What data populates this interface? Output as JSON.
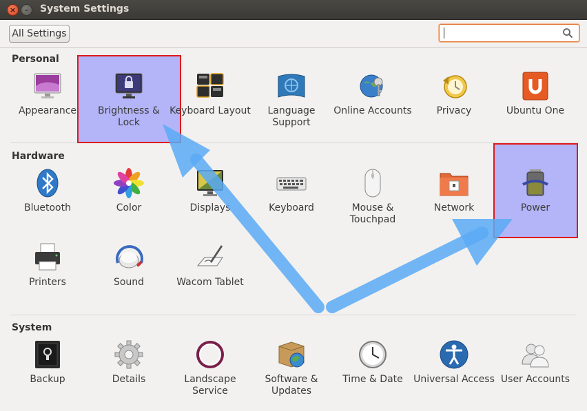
{
  "window": {
    "title": "System Settings",
    "close_glyph": "×",
    "min_glyph": "–"
  },
  "toolbar": {
    "all_settings_label": "All Settings",
    "search_value": ""
  },
  "sections": {
    "personal": "Personal",
    "hardware": "Hardware",
    "system": "System"
  },
  "personal": {
    "appearance": "Appearance",
    "brightness_lock": "Brightness & Lock",
    "keyboard_layout": "Keyboard Layout",
    "language_support": "Language Support",
    "online_accounts": "Online Accounts",
    "privacy": "Privacy",
    "ubuntu_one": "Ubuntu One"
  },
  "hardware": {
    "bluetooth": "Bluetooth",
    "color": "Color",
    "displays": "Displays",
    "keyboard": "Keyboard",
    "mouse_touchpad": "Mouse & Touchpad",
    "network": "Network",
    "power": "Power",
    "printers": "Printers",
    "sound": "Sound",
    "wacom_tablet": "Wacom Tablet"
  },
  "system": {
    "backup": "Backup",
    "details": "Details",
    "landscape_service": "Landscape Service",
    "software_updates": "Software & Updates",
    "time_date": "Time & Date",
    "universal_access": "Universal Access",
    "user_accounts": "User Accounts"
  },
  "colors": {
    "highlight_border": "#e01a1a",
    "highlight_fill": "#8282ff",
    "arrow": "#5aaaf5",
    "search_border": "#e07a3a"
  }
}
